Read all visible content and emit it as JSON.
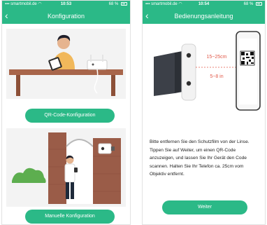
{
  "colors": {
    "accent": "#2bb987",
    "dimension_text": "#e25a4a"
  },
  "left_screen": {
    "status_bar": {
      "carrier": "smartmobil.de",
      "time": "10:53",
      "battery": "68 %"
    },
    "nav": {
      "back_icon": "chevron-left-icon",
      "title": "Konfiguration"
    },
    "qr_button_label": "QR-Code-Konfiguration",
    "manual_button_label": "Manuelle Konfiguration"
  },
  "right_screen": {
    "status_bar": {
      "carrier": "smartmobil.de",
      "time": "10:54",
      "battery": "68 %"
    },
    "nav": {
      "back_icon": "chevron-left-icon",
      "title": "Bedienungsanleitung"
    },
    "illustration": {
      "distance_cm": "15~25cm",
      "distance_in": "5~8 in"
    },
    "instruction": "Bitte entfernen Sie den Schutzfilm von der Linse. Tippen Sie auf Weiter, um einen QR-Code anzuzeigen, und lassen Sie Ihr Gerät den Code scannen. Halten Sie Ihr Telefon ca. 25cm vom Objektiv entfernt.",
    "continue_button_label": "Weiter"
  }
}
